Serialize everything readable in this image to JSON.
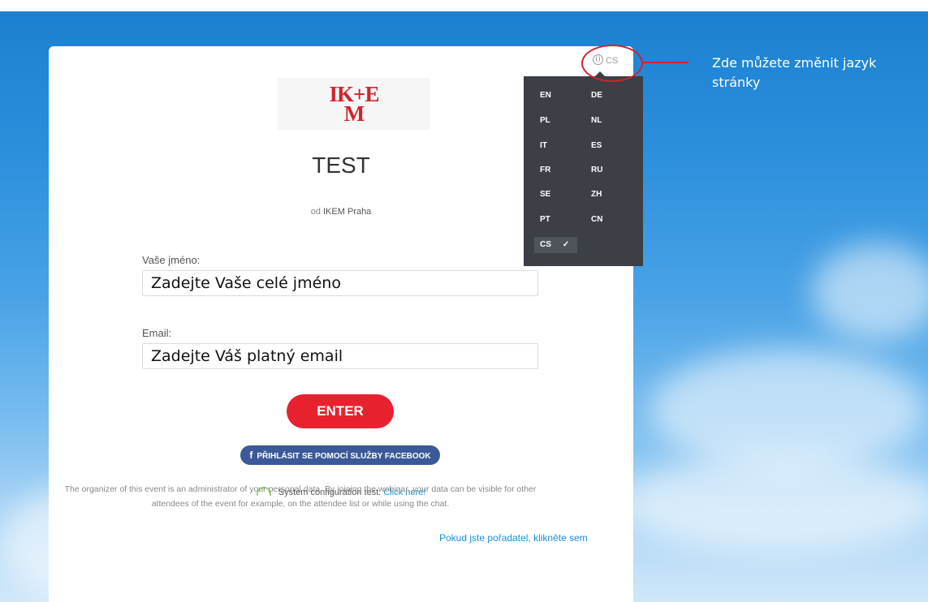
{
  "logo": {
    "line1": "IK+E",
    "line2": "M"
  },
  "event": {
    "title": "TEST",
    "organizer_prefix": "od",
    "organizer_name": "IKEM Praha"
  },
  "form": {
    "name_label": "Vaše jméno:",
    "name_placeholder": "Zadejte Vaše celé jméno",
    "email_label": "Email:",
    "email_placeholder": "Zadejte Váš platný email",
    "enter_label": "ENTER",
    "facebook_icon": "f",
    "facebook_label": "PŘIHLÁSIT SE POMOCÍ SLUŽBY FACEBOOK"
  },
  "system_test": {
    "text": "System configuration test.",
    "link": "Click here!"
  },
  "disclaimer": "The organizer of this event is an administrator of your personal data. By joining the webinar, your data can be visible for other attendees of the event for example, on the attendee list or while using the chat.",
  "organizer_link": "Pokud jste pořadatel, klikněte sem",
  "language": {
    "current": "CS",
    "options_left": [
      "EN",
      "PL",
      "IT",
      "FR",
      "SE",
      "PT",
      "CS"
    ],
    "options_right": [
      "DE",
      "NL",
      "ES",
      "RU",
      "ZH",
      "CN"
    ],
    "selected_mark": "✓"
  },
  "annotation": {
    "text": "Zde můžete změnit jazyk stránky",
    "color": "#d1232a"
  },
  "colors": {
    "enter": "#e8212e",
    "facebook": "#3b5998",
    "link": "#1b8fd8",
    "dropdown_bg": "#3c3f45"
  }
}
